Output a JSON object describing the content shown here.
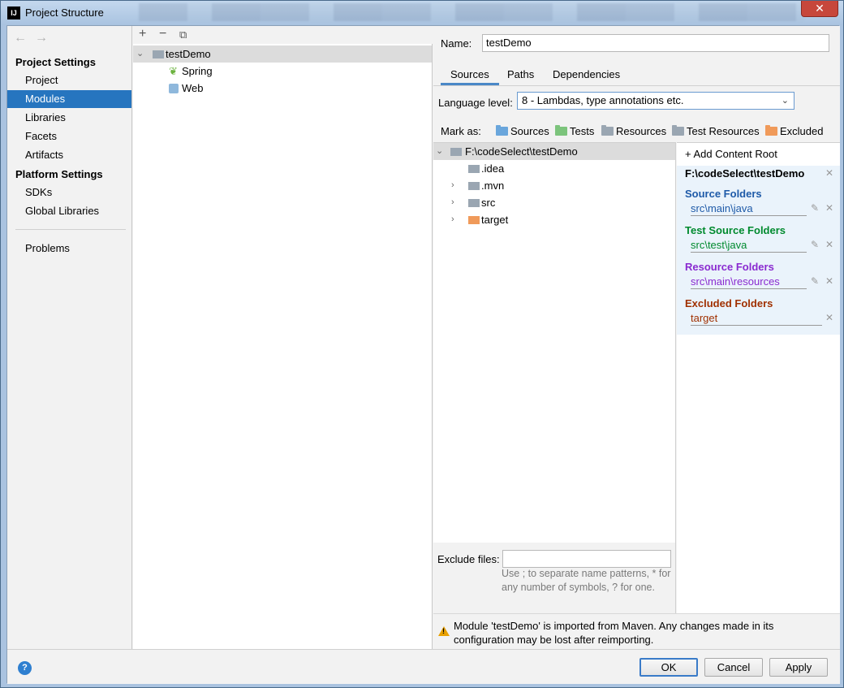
{
  "window": {
    "title": "Project Structure",
    "close": "✕"
  },
  "left": {
    "project_settings_header": "Project Settings",
    "items1": [
      "Project",
      "Modules",
      "Libraries",
      "Facets",
      "Artifacts"
    ],
    "platform_settings_header": "Platform Settings",
    "items2": [
      "SDKs",
      "Global Libraries"
    ],
    "problems": "Problems",
    "selected": "Modules"
  },
  "modules_tree": {
    "root": "testDemo",
    "children": [
      "Spring",
      "Web"
    ]
  },
  "module": {
    "name_label": "Name:",
    "name_value": "testDemo",
    "tabs": [
      "Sources",
      "Paths",
      "Dependencies"
    ],
    "active_tab": "Sources",
    "language_level_label": "Language level:",
    "language_level_value": "8 - Lambdas, type annotations etc.",
    "mark_as_label": "Mark as:",
    "mark_as": [
      "Sources",
      "Tests",
      "Resources",
      "Test Resources",
      "Excluded"
    ]
  },
  "file_tree": {
    "root": "F:\\codeSelect\\testDemo",
    "children": [
      ".idea",
      ".mvn",
      "src",
      "target"
    ]
  },
  "content_roots": {
    "add_label": "Add Content Root",
    "root_path": "F:\\codeSelect\\testDemo",
    "source_header": "Source Folders",
    "source_path": "src\\main\\java",
    "test_header": "Test Source Folders",
    "test_path": "src\\test\\java",
    "resource_header": "Resource Folders",
    "resource_path": "src\\main\\resources",
    "excluded_header": "Excluded Folders",
    "excluded_path": "target",
    "colors": {
      "source": "#1e5aa8",
      "test": "#008a2e",
      "resource": "#8a2ad0",
      "excluded": "#a03000"
    }
  },
  "exclude_files": {
    "label": "Exclude files:",
    "hint": "Use ; to separate name patterns, * for any number of symbols, ? for one."
  },
  "warning": "Module 'testDemo' is imported from Maven. Any changes made in its configuration may be lost after reimporting.",
  "footer": {
    "ok": "OK",
    "cancel": "Cancel",
    "apply": "Apply",
    "help": "?"
  }
}
